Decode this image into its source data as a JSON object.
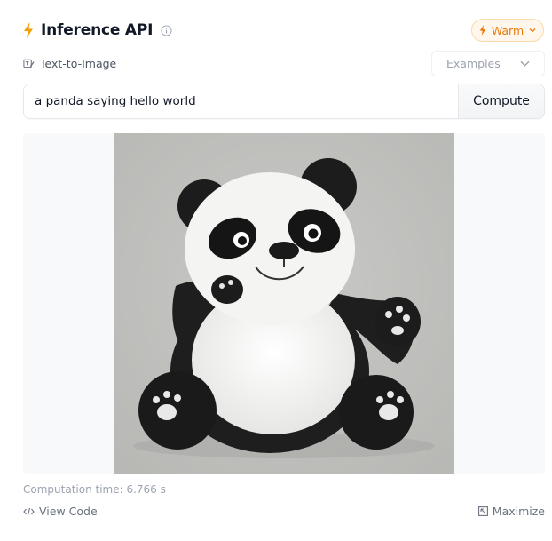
{
  "header": {
    "title": "Inference API",
    "status_label": "Warm",
    "icons": {
      "title": "lightning-icon",
      "info": "info-icon",
      "status": "lightning-icon",
      "dropdown": "chevron-down-icon"
    }
  },
  "task": {
    "label": "Text-to-Image",
    "icon": "text-to-image-icon"
  },
  "examples": {
    "label": "Examples"
  },
  "prompt": {
    "value": "a panda saying hello world",
    "placeholder": ""
  },
  "compute": {
    "label": "Compute"
  },
  "output": {
    "subject": "cartoon panda waving"
  },
  "footer": {
    "computation_time": "Computation time: 6.766 s",
    "view_code": "View Code",
    "maximize": "Maximize"
  },
  "colors": {
    "accent": "#f59e0b",
    "warm_bg": "#fff7ed",
    "warm_text": "#ea7a0c",
    "muted_text": "#9ca3af"
  }
}
